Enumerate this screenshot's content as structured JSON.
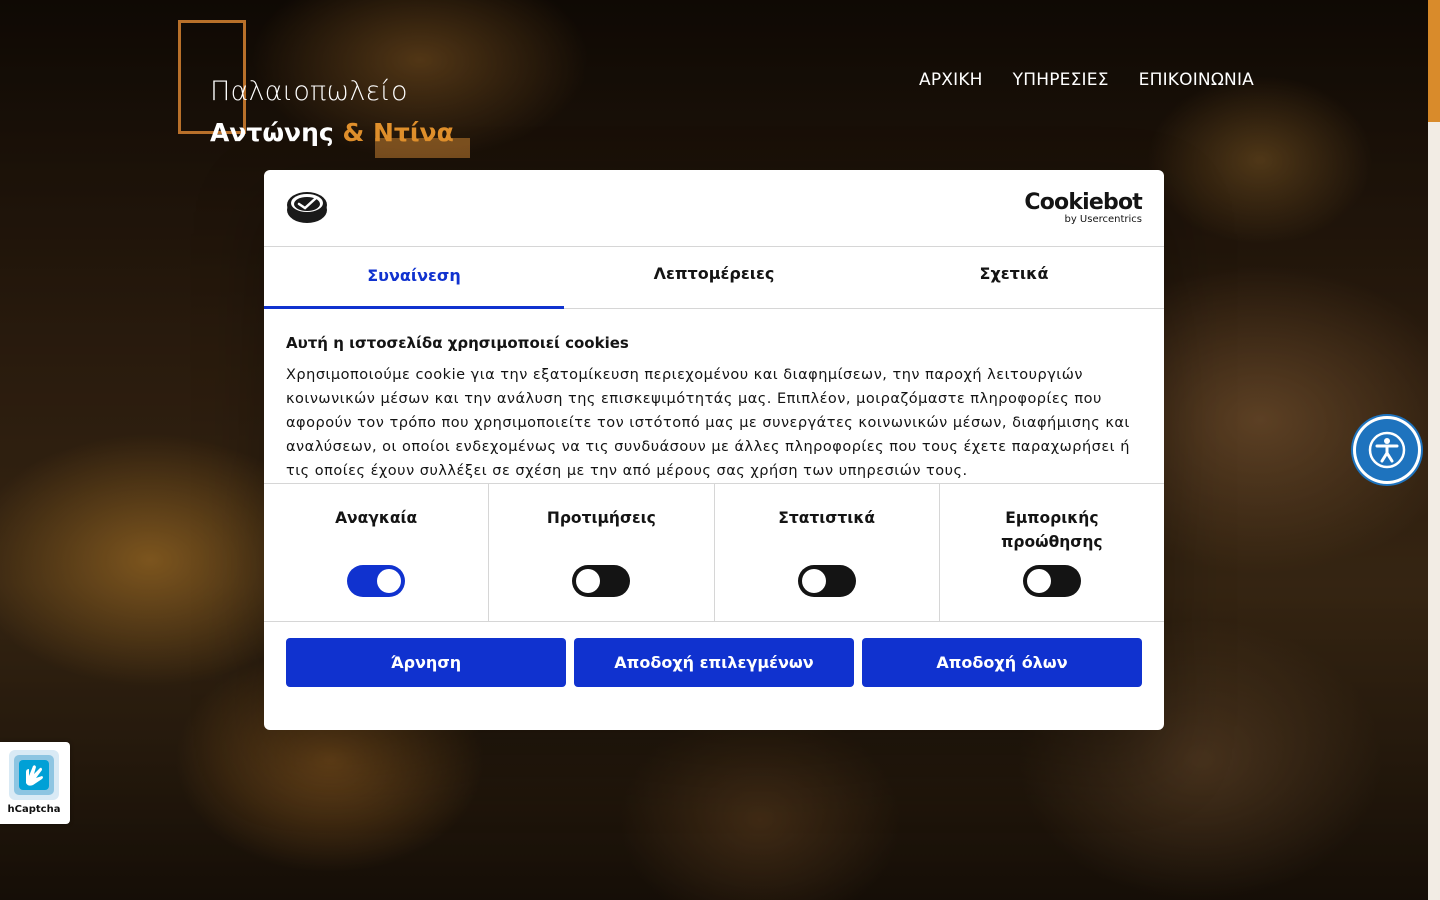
{
  "site": {
    "logo_line1": "Παλαιοπωλείο",
    "logo_line2_part1": "Αντώνης",
    "logo_line2_part2": "& Ντίνα",
    "accent_color": "#d98b2b"
  },
  "nav": {
    "items": [
      "ΑΡΧΙΚΗ",
      "ΥΠΗΡΕΣΙΕΣ",
      "ΕΠΙΚΟΙΝΩΝΙΑ"
    ]
  },
  "cookie_dialog": {
    "brand_name": "Cookiebot",
    "brand_sub": "by Usercentrics",
    "tabs": [
      "Συναίνεση",
      "Λεπτομέρειες",
      "Σχετικά"
    ],
    "active_tab": "Συναίνεση",
    "title": "Αυτή η ιστοσελίδα χρησιμοποιεί cookies",
    "description": "Χρησιμοποιούμε cookie για την εξατομίκευση περιεχομένου και διαφημίσεων, την παροχή λειτουργιών κοινωνικών μέσων και την ανάλυση της επισκεψιμότητάς μας. Επιπλέον, μοιραζόμαστε πληροφορίες που αφορούν τον τρόπο που χρησιμοποιείτε τον ιστότοπό μας με συνεργάτες κοινωνικών μέσων, διαφήμισης και αναλύσεων, οι οποίοι ενδεχομένως να τις συνδυάσουν με άλλες πληροφορίες που τους έχετε παραχωρήσει ή τις οποίες έχουν συλλέξει σε σχέση με την από μέρους σας χρήση των υπηρεσιών τους.",
    "categories": [
      {
        "label": "Αναγκαία",
        "enabled": true
      },
      {
        "label": "Προτιμήσεις",
        "enabled": false
      },
      {
        "label": "Στατιστικά",
        "enabled": false
      },
      {
        "label": "Εμπορικής προώθησης",
        "enabled": false
      }
    ],
    "buttons": {
      "deny": "Άρνηση",
      "allow_selected": "Αποδοχή επιλεγμένων",
      "allow_all": "Αποδοχή όλων"
    },
    "accent_color": "#1032cf"
  },
  "captcha": {
    "label": "hCaptcha"
  },
  "accessibility": {
    "icon": "accessibility-icon",
    "color": "#1e73be"
  }
}
